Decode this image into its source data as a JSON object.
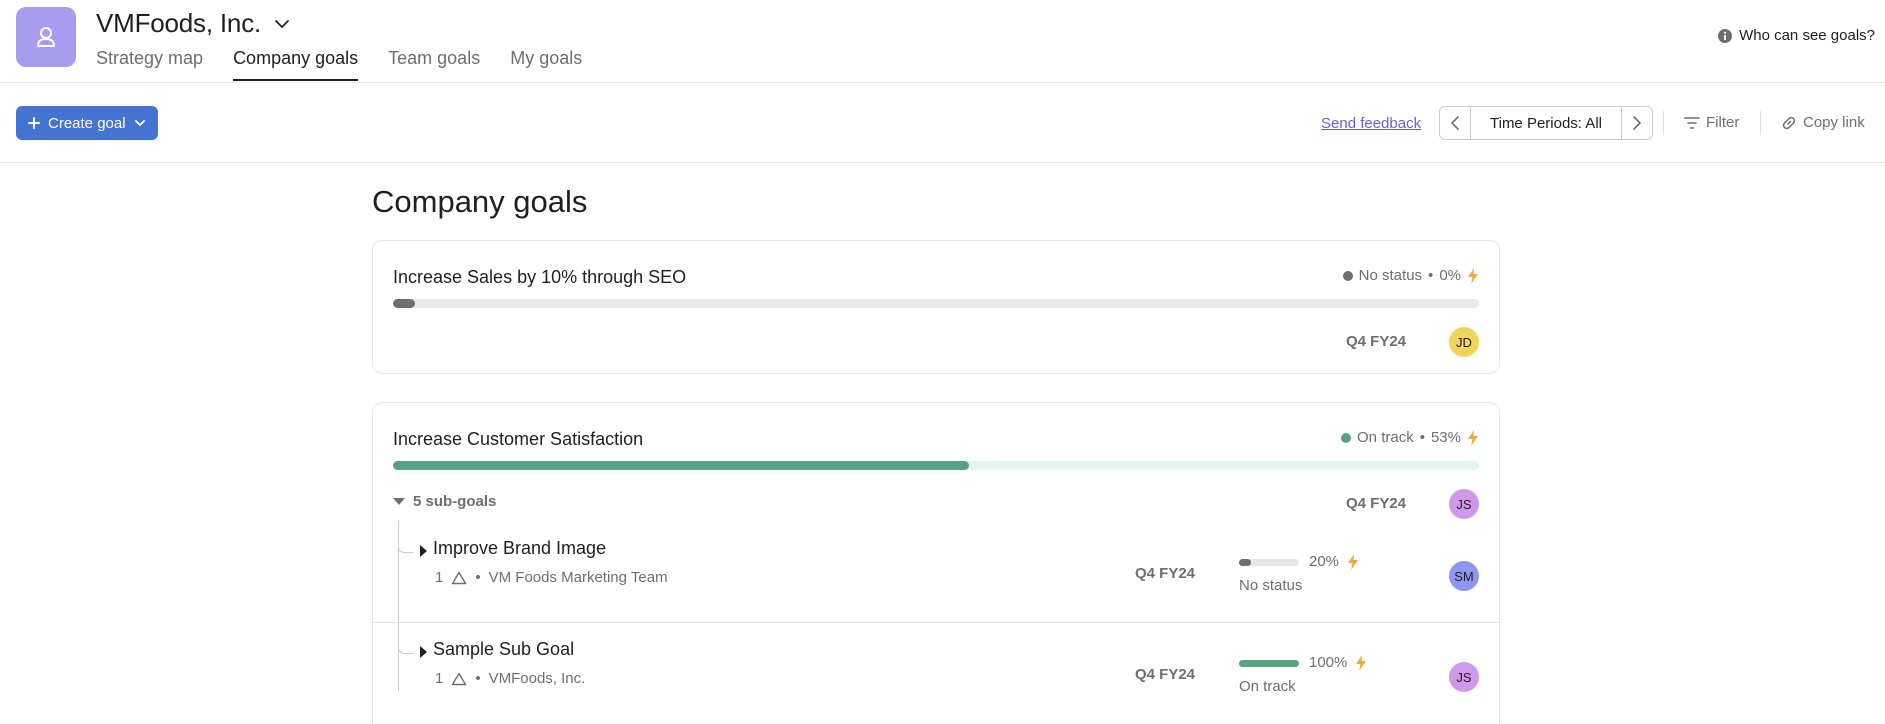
{
  "header": {
    "org_name": "VMFoods, Inc.",
    "org_avatar_icon": "user-outline-icon",
    "tabs": [
      {
        "label": "Strategy map",
        "active": false
      },
      {
        "label": "Company goals",
        "active": true
      },
      {
        "label": "Team goals",
        "active": false
      },
      {
        "label": "My goals",
        "active": false
      }
    ],
    "who_can_see": "Who can see goals?"
  },
  "toolbar": {
    "create_label": "Create goal",
    "send_feedback": "Send feedback",
    "time_periods": "Time Periods: All",
    "filter": "Filter",
    "copy_link": "Copy link"
  },
  "page": {
    "title": "Company goals"
  },
  "goals": [
    {
      "title": "Increase Sales by 10% through SEO",
      "status": "No status",
      "percent": "0%",
      "progress_fraction": 0.02,
      "status_color": "#6d6e6f",
      "fill_color": "#6d6e6f",
      "track_color": "#ece9e9",
      "period": "Q4 FY24",
      "owner_initials": "JD",
      "owner_color": "#f1d55b"
    },
    {
      "title": "Increase Customer Satisfaction",
      "status": "On track",
      "percent": "53%",
      "progress_fraction": 0.53,
      "status_color": "#58a182",
      "fill_color": "#58a182",
      "track_color": "#e4f5ee",
      "period": "Q4 FY24",
      "owner_initials": "JS",
      "owner_color": "#cf98e8",
      "subgoals_label": "5 sub-goals",
      "subgoals": [
        {
          "title": "Improve Brand Image",
          "count": "1",
          "team": "VM Foods Marketing Team",
          "period": "Q4 FY24",
          "percent": "20%",
          "progress_fraction": 0.2,
          "fill_color": "#6d6e6f",
          "status": "No status",
          "owner_initials": "SM",
          "owner_color": "#8d97ef"
        },
        {
          "title": "Sample Sub Goal",
          "count": "1",
          "team": "VMFoods, Inc.",
          "period": "Q4 FY24",
          "percent": "100%",
          "progress_fraction": 1.0,
          "fill_color": "#58a182",
          "status": "On track",
          "owner_initials": "JS",
          "owner_color": "#cf98e8"
        }
      ]
    }
  ],
  "colors": {
    "accent": "#4573d2",
    "lightning": "#f1a83b",
    "link": "#6a5fd6"
  }
}
